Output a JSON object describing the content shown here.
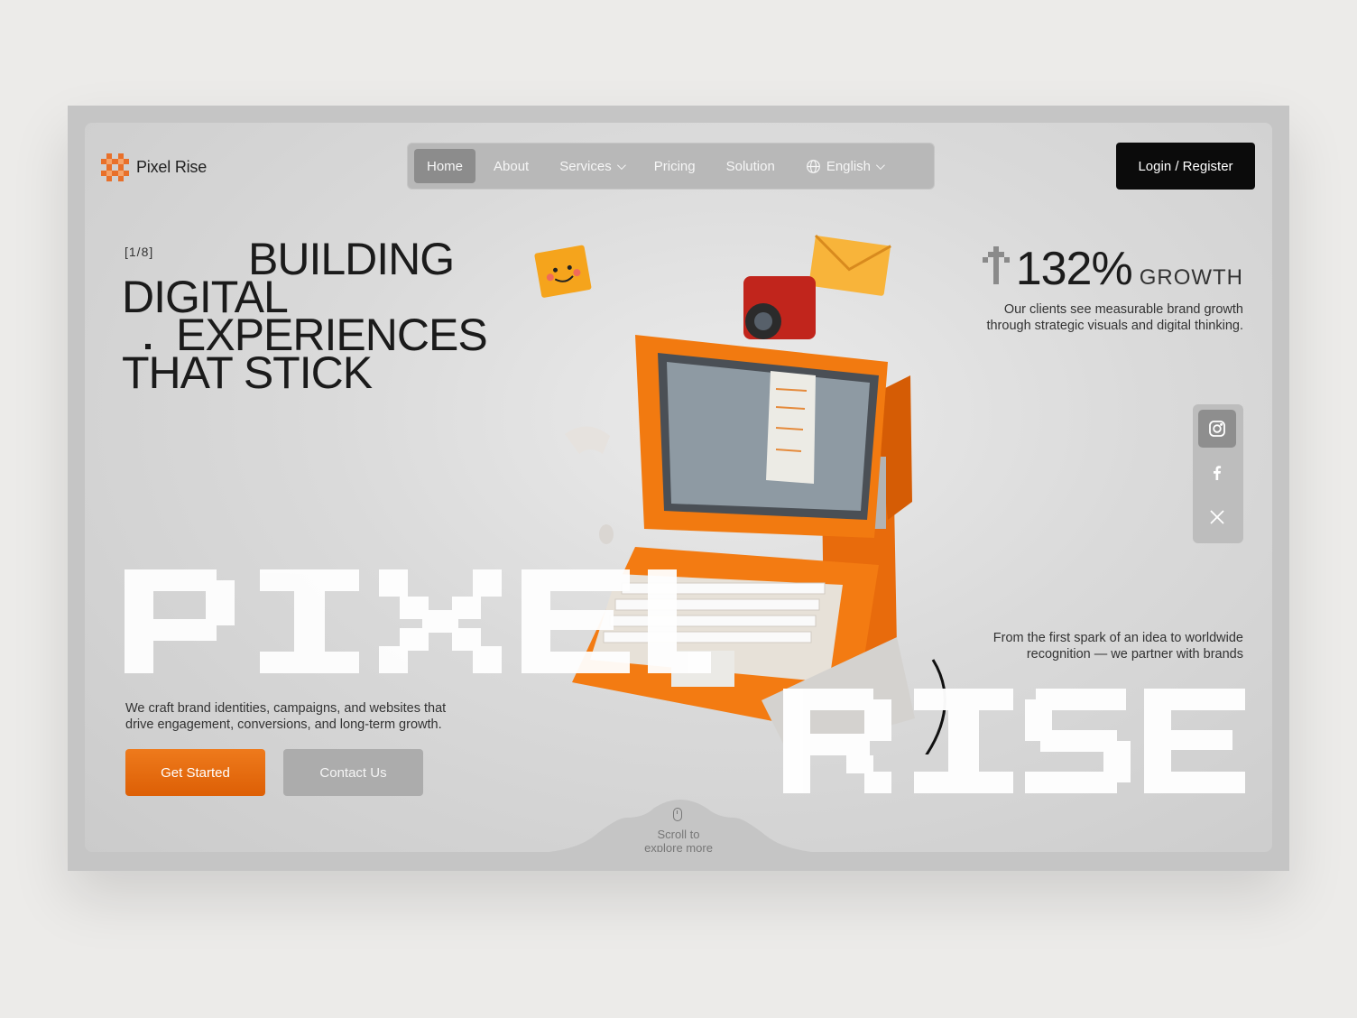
{
  "brand": {
    "name": "Pixel Rise",
    "logo_icon": "pixel-grid-logo-icon",
    "accent": "#e86a10"
  },
  "nav": {
    "items": [
      {
        "label": "Home",
        "active": true
      },
      {
        "label": "About",
        "active": false
      },
      {
        "label": "Services",
        "active": false,
        "dropdown": true
      },
      {
        "label": "Pricing",
        "active": false
      },
      {
        "label": "Solution",
        "active": false
      },
      {
        "label": "English",
        "active": false,
        "dropdown": true,
        "icon": "globe-icon"
      }
    ],
    "login_label": "Login / Register"
  },
  "hero": {
    "counter": "[1/8]",
    "headline": [
      "BUILDING",
      "DIGITAL",
      "EXPERIENCES",
      "THAT STICK"
    ],
    "growth_value": "132%",
    "growth_label": "GROWTH",
    "growth_desc": "Our clients see measurable brand growth through strategic visuals and digital thinking.",
    "partner_text": "From the first spark of an idea to worldwide recognition — we partner with brands",
    "craft_text": "We craft brand identities, campaigns, and websites that drive engagement, conversions, and long-term growth.",
    "primary_cta": "Get Started",
    "secondary_cta": "Contact Us",
    "big_word_1": "PIXEL",
    "big_word_2": "RISE",
    "scroll_text_1": "Scroll to",
    "scroll_text_2": "explore more"
  },
  "social": [
    {
      "icon": "instagram-icon",
      "active": true
    },
    {
      "icon": "facebook-icon",
      "active": false
    },
    {
      "icon": "x-icon",
      "active": false
    }
  ],
  "colors": {
    "primary_button": "#e5690e",
    "nav_bg": "#b8b8b8",
    "dark_button": "#0b0b0b"
  }
}
